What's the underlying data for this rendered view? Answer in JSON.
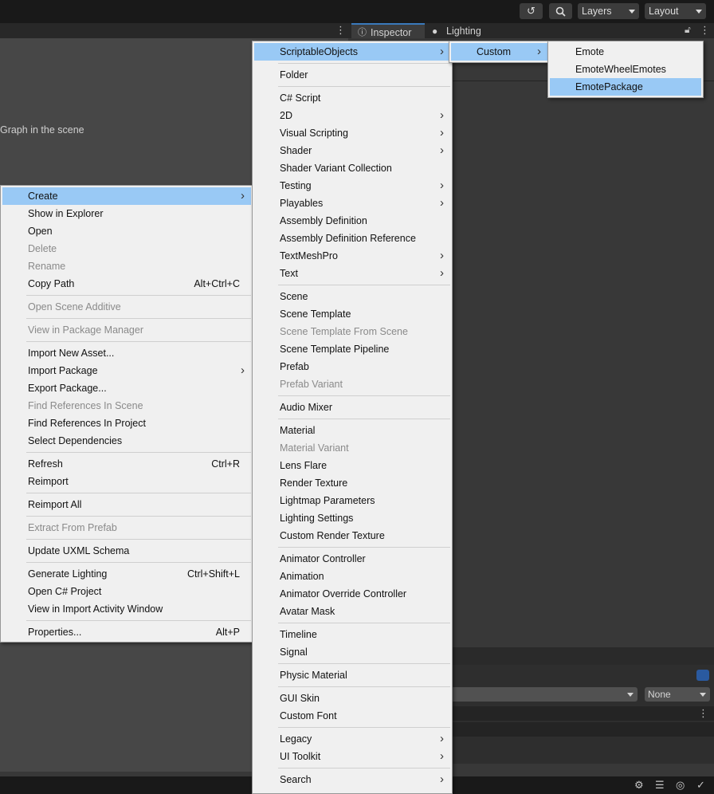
{
  "toolbar": {
    "history_icon": "history-icon",
    "search_icon": "search-icon",
    "layers_label": "Layers",
    "layout_label": "Layout"
  },
  "tabs": {
    "inspector": "Inspector",
    "lighting": "Lighting"
  },
  "scene": {
    "hint_text": "Graph in the scene"
  },
  "context_menu": {
    "items": [
      {
        "label": "Create",
        "submenu": true,
        "highlighted": true
      },
      {
        "label": "Show in Explorer"
      },
      {
        "label": "Open"
      },
      {
        "label": "Delete",
        "disabled": true
      },
      {
        "label": "Rename",
        "disabled": true
      },
      {
        "label": "Copy Path",
        "shortcut": "Alt+Ctrl+C"
      },
      {
        "separator": true
      },
      {
        "label": "Open Scene Additive",
        "disabled": true
      },
      {
        "separator": true
      },
      {
        "label": "View in Package Manager",
        "disabled": true
      },
      {
        "separator": true
      },
      {
        "label": "Import New Asset..."
      },
      {
        "label": "Import Package",
        "submenu": true
      },
      {
        "label": "Export Package..."
      },
      {
        "label": "Find References In Scene",
        "disabled": true
      },
      {
        "label": "Find References In Project"
      },
      {
        "label": "Select Dependencies"
      },
      {
        "separator": true
      },
      {
        "label": "Refresh",
        "shortcut": "Ctrl+R"
      },
      {
        "label": "Reimport"
      },
      {
        "separator": true
      },
      {
        "label": "Reimport All"
      },
      {
        "separator": true
      },
      {
        "label": "Extract From Prefab",
        "disabled": true
      },
      {
        "separator": true
      },
      {
        "label": "Update UXML Schema"
      },
      {
        "separator": true
      },
      {
        "label": "Generate Lighting",
        "shortcut": "Ctrl+Shift+L"
      },
      {
        "label": "Open C# Project"
      },
      {
        "label": "View in Import Activity Window"
      },
      {
        "separator": true
      },
      {
        "label": "Properties...",
        "shortcut": "Alt+P"
      }
    ]
  },
  "create_menu": {
    "items": [
      {
        "label": "ScriptableObjects",
        "submenu": true,
        "highlighted": true
      },
      {
        "separator": true
      },
      {
        "label": "Folder"
      },
      {
        "separator": true
      },
      {
        "label": "C# Script"
      },
      {
        "label": "2D",
        "submenu": true
      },
      {
        "label": "Visual Scripting",
        "submenu": true
      },
      {
        "label": "Shader",
        "submenu": true
      },
      {
        "label": "Shader Variant Collection"
      },
      {
        "label": "Testing",
        "submenu": true
      },
      {
        "label": "Playables",
        "submenu": true
      },
      {
        "label": "Assembly Definition"
      },
      {
        "label": "Assembly Definition Reference"
      },
      {
        "label": "TextMeshPro",
        "submenu": true
      },
      {
        "label": "Text",
        "submenu": true
      },
      {
        "separator": true
      },
      {
        "label": "Scene"
      },
      {
        "label": "Scene Template"
      },
      {
        "label": "Scene Template From Scene",
        "disabled": true
      },
      {
        "label": "Scene Template Pipeline"
      },
      {
        "label": "Prefab"
      },
      {
        "label": "Prefab Variant",
        "disabled": true
      },
      {
        "separator": true
      },
      {
        "label": "Audio Mixer"
      },
      {
        "separator": true
      },
      {
        "label": "Material"
      },
      {
        "label": "Material Variant",
        "disabled": true
      },
      {
        "label": "Lens Flare"
      },
      {
        "label": "Render Texture"
      },
      {
        "label": "Lightmap Parameters"
      },
      {
        "label": "Lighting Settings"
      },
      {
        "label": "Custom Render Texture"
      },
      {
        "separator": true
      },
      {
        "label": "Animator Controller"
      },
      {
        "label": "Animation"
      },
      {
        "label": "Animator Override Controller"
      },
      {
        "label": "Avatar Mask"
      },
      {
        "separator": true
      },
      {
        "label": "Timeline"
      },
      {
        "label": "Signal"
      },
      {
        "separator": true
      },
      {
        "label": "Physic Material"
      },
      {
        "separator": true
      },
      {
        "label": "GUI Skin"
      },
      {
        "label": "Custom Font"
      },
      {
        "separator": true
      },
      {
        "label": "Legacy",
        "submenu": true
      },
      {
        "label": "UI Toolkit",
        "submenu": true
      },
      {
        "separator": true
      },
      {
        "label": "Search",
        "submenu": true
      }
    ]
  },
  "scriptable_objects_menu": {
    "items": [
      {
        "label": "Custom",
        "submenu": true,
        "highlighted": true
      }
    ]
  },
  "custom_menu": {
    "items": [
      {
        "label": "Emote"
      },
      {
        "label": "EmoteWheelEmotes"
      },
      {
        "label": "EmotePackage",
        "highlighted": true
      }
    ]
  },
  "bottom_panel": {
    "select_right_value": "None"
  },
  "colors": {
    "menu_highlight": "#99c9f5",
    "menu_background": "#f0f0f0",
    "editor_dark": "#191919",
    "tab_active_accent": "#3a79bb"
  }
}
